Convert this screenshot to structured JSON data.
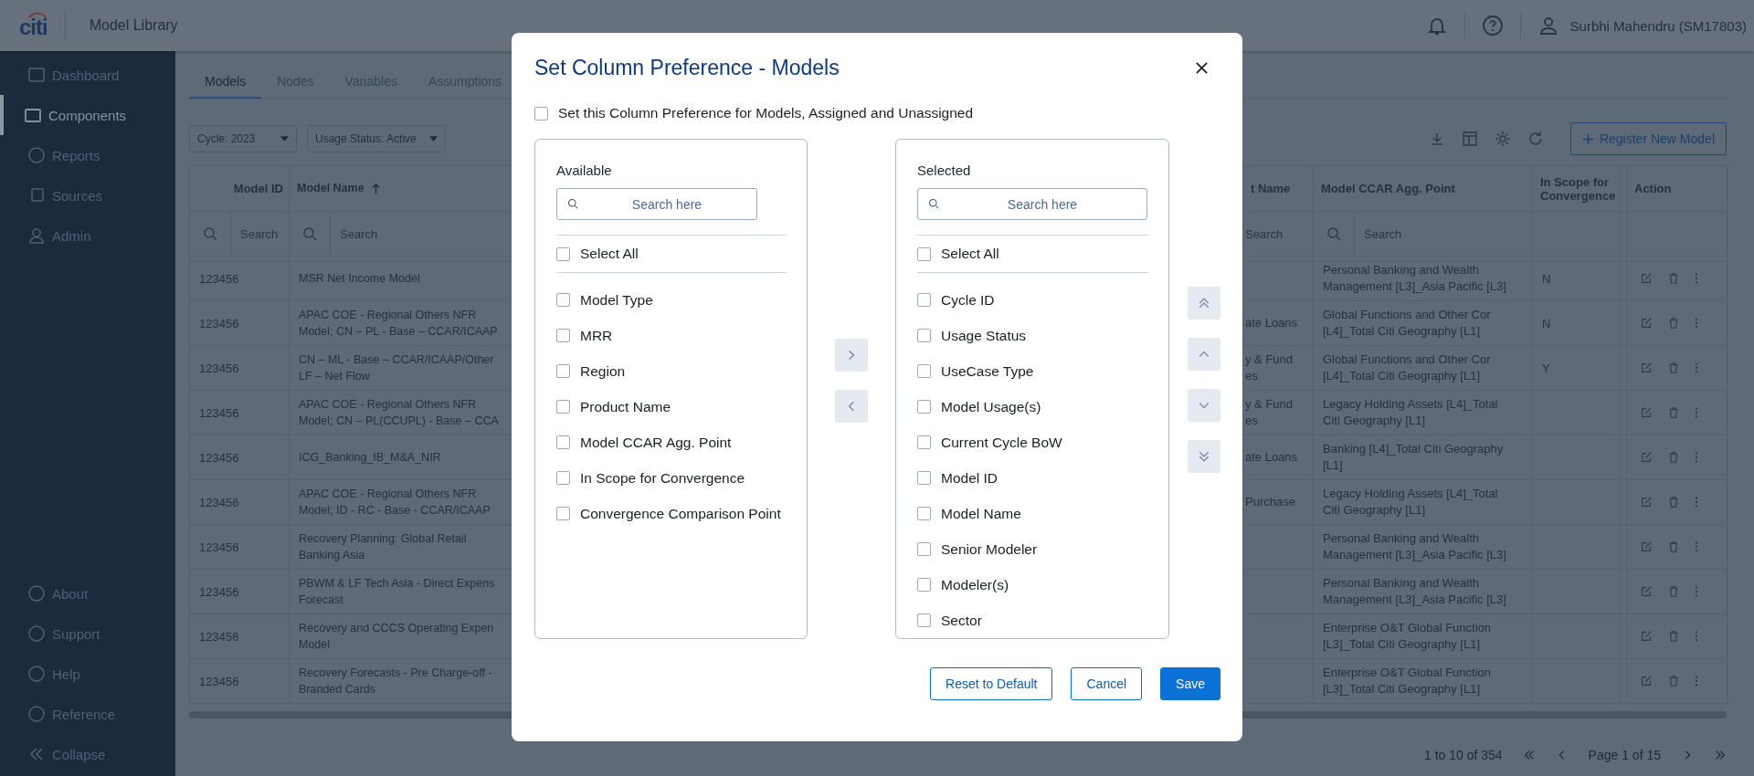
{
  "header": {
    "logo": "citi",
    "app_title": "Model Library",
    "user_name": "Surbhi Mahendru (SM17803)"
  },
  "sidebar": {
    "items": [
      {
        "label": "Dashboard",
        "selected": false
      },
      {
        "label": "Components",
        "selected": true
      },
      {
        "label": "Reports",
        "selected": false
      },
      {
        "label": "Sources",
        "selected": false
      },
      {
        "label": "Admin",
        "selected": false
      }
    ],
    "footer_items": [
      {
        "label": "About"
      },
      {
        "label": "Support"
      },
      {
        "label": "Help"
      },
      {
        "label": "Reference"
      },
      {
        "label": "Collapse"
      }
    ]
  },
  "tabs": [
    {
      "label": "Models",
      "selected": true
    },
    {
      "label": "Nodes",
      "selected": false
    },
    {
      "label": "Variables",
      "selected": false
    },
    {
      "label": "Assumptions",
      "selected": false
    }
  ],
  "filters": [
    "Cycle: 2023",
    "Usage Status: Active"
  ],
  "register_button": "Register New Model",
  "table": {
    "columns": [
      {
        "label": "Model ID",
        "sorted": false,
        "search_placeholder": "Search",
        "search_icon": true
      },
      {
        "label": "Model Name",
        "sorted": true,
        "search_placeholder": "Search",
        "search_icon": true
      },
      {
        "label": "t Name",
        "sorted": false,
        "search_placeholder": "Search",
        "search_icon": false
      },
      {
        "label": "Model CCAR Agg. Point",
        "sorted": false,
        "search_placeholder": "Search",
        "search_icon": true
      },
      {
        "label": "In Scope for Convergence",
        "sorted": false
      },
      {
        "label": "Action",
        "sorted": false
      }
    ],
    "rows": [
      {
        "model_id": "123456",
        "model_name": "MSR Net Income Model",
        "ccar_point": "Personal Banking and Wealth\nManagement [L3]_Asia Pacific [L3]",
        "in_scope": "N"
      },
      {
        "model_id": "123456",
        "model_name": "APAC COE - Regional Others NFR\nModel; CN – PL - Base – CCAR/ICAAP",
        "column_3": "ate Loans",
        "ccar_point": "Global Functions and Other Cor\n[L4]_Total Citi Geography [L1]",
        "in_scope": "N"
      },
      {
        "model_id": "123456",
        "model_name": "CN – ML - Base – CCAR/ICAAP/Other\nLF – Net Flow",
        "column_3": "y & Fund\nes",
        "ccar_point": "Global Functions and Other Cor\n[L4]_Total Citi Geography [L1]",
        "in_scope": "Y"
      },
      {
        "model_id": "123456",
        "model_name": "APAC COE - Regional Others NFR\nModel; CN – PL(CCUPL) - Base – CCA",
        "column_3": "y & Fund\nes",
        "ccar_point": "Legacy Holding Assets [L4]_Total\nCiti Geography [L1]"
      },
      {
        "model_id": "123456",
        "model_name": "ICG_Banking_IB_M&A_NIR",
        "column_3": "ate Loans",
        "ccar_point": "Banking [L4]_Total Citi Geography\n[L1]"
      },
      {
        "model_id": "123456",
        "model_name": "APAC COE - Regional Others NFR\nModel; ID - RC - Base - CCAR/ICAAP",
        "column_3": "Purchase",
        "ccar_point": "Legacy Holding Assets [L4]_Total\nCiti Geography [L1]"
      },
      {
        "model_id": "123456",
        "model_name": "Recovery Planning: Global Retail\nBanking Asia",
        "ccar_point": "Personal Banking and Wealth\nManagement [L3]_Asia Pacific [L3]"
      },
      {
        "model_id": "123456",
        "model_name": "PBWM & LF Tech Asia - Direct Expens\nForecast",
        "ccar_point": "Personal Banking and Wealth\nManagement [L3]_Asia Pacific [L3]"
      },
      {
        "model_id": "123456",
        "model_name": "Recovery and CCCS Operating Expen\nModel",
        "ccar_point": "Enterprise O&T Global Function\n[L3]_Total Citi Geography [L1]"
      },
      {
        "model_id": "123456",
        "model_name": "Recovery Forecasts - Pre Charge-off -\nBranded Cards",
        "ccar_point": "Enterprise O&T Global Function\n[L3]_Total Citi Geography [L1]"
      }
    ]
  },
  "pagination": {
    "range": "1 to 10 of 354",
    "page": "Page 1 of 15"
  },
  "modal": {
    "title": "Set Column Preference - Models",
    "apply_all": {
      "label": "Set this Column Preference for Models, Assigned and Unassigned",
      "checked": false
    },
    "available": {
      "heading": "Available",
      "search_placeholder": "Search here",
      "select_all": {
        "label": "Select All",
        "checked": false
      },
      "items": [
        {
          "label": "Model Type",
          "checked": false
        },
        {
          "label": "MRR",
          "checked": false
        },
        {
          "label": "Region",
          "checked": false
        },
        {
          "label": "Product Name",
          "checked": false
        },
        {
          "label": "Model CCAR Agg. Point",
          "checked": false
        },
        {
          "label": "In Scope for Convergence",
          "checked": false
        },
        {
          "label": "Convergence Comparison Point",
          "checked": false
        }
      ]
    },
    "selected": {
      "heading": "Selected",
      "search_placeholder": "Search here",
      "select_all": {
        "label": "Select All",
        "checked": false
      },
      "items": [
        {
          "label": "Cycle ID",
          "checked": false
        },
        {
          "label": "Usage Status",
          "checked": false
        },
        {
          "label": "UseCase Type",
          "checked": false
        },
        {
          "label": "Model Usage(s)",
          "checked": false
        },
        {
          "label": "Current Cycle BoW",
          "checked": false
        },
        {
          "label": "Model ID",
          "checked": false
        },
        {
          "label": "Model Name",
          "checked": false
        },
        {
          "label": "Senior Modeler",
          "checked": false
        },
        {
          "label": "Modeler(s)",
          "checked": false
        },
        {
          "label": "Sector",
          "checked": false
        }
      ]
    },
    "buttons": [
      {
        "label": "Reset to Default",
        "kind": "outline"
      },
      {
        "label": "Cancel",
        "kind": "outline"
      },
      {
        "label": "Save",
        "kind": "primary"
      }
    ]
  }
}
